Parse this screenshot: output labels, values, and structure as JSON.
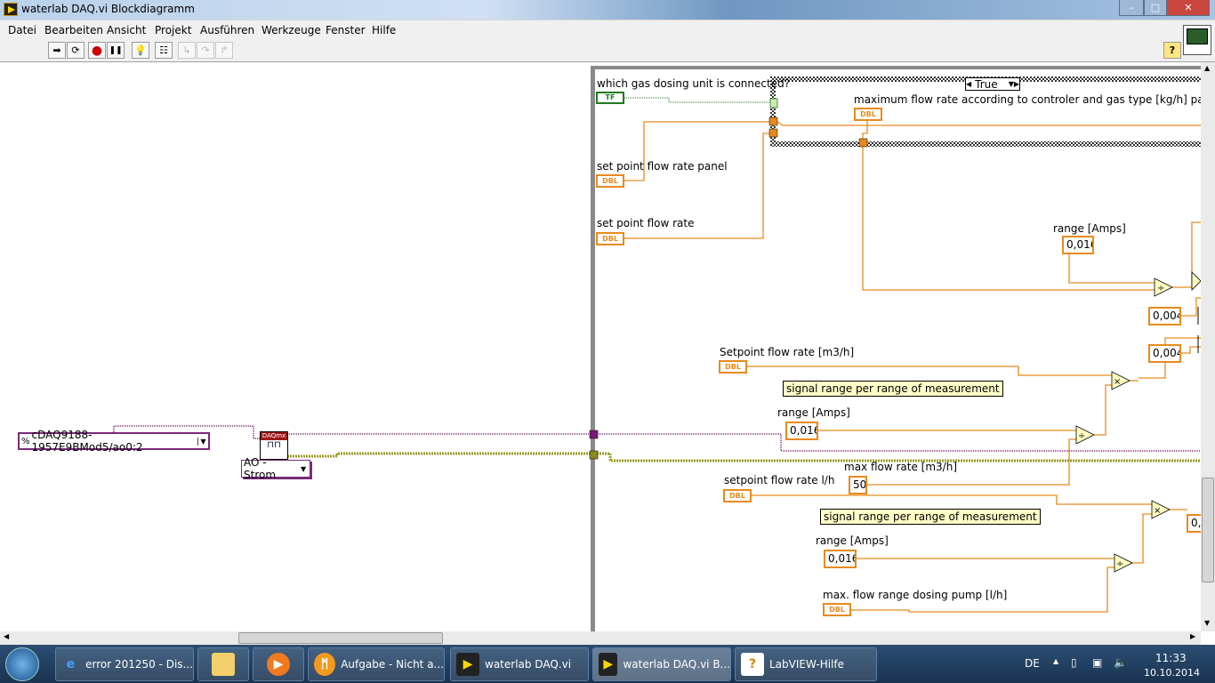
{
  "window": {
    "title": "waterlab DAQ.vi Blockdiagramm",
    "controls": {
      "minimize": "–",
      "maximize": "□",
      "close": "✕"
    }
  },
  "menu": [
    "Datei",
    "Bearbeiten",
    "Ansicht",
    "Projekt",
    "Ausführen",
    "Werkzeuge",
    "Fenster",
    "Hilfe"
  ],
  "toolbar": {
    "run": "➡",
    "run_continuously": "⟳",
    "abort": "●",
    "pause": "❚❚",
    "highlight": "💡",
    "retain_wire_values": "☷",
    "step_into": "↳",
    "step_over": "↷",
    "step_out": "↱",
    "help": "?"
  },
  "diagram": {
    "daq_channel": "cDAQ9188-1957E9BMod5/ao0:2",
    "daq_node_label": "DAQmx",
    "daq_task_type": "AO - Strom",
    "gas_unit_label": "which gas dosing unit is connected?",
    "tf_control": "TF",
    "case_selector": "True",
    "case_selector_prefix": "?",
    "max_flow_rate_label": "maximum flow rate according to controler and gas type [kg/h] par",
    "set_point_panel_label": "set point flow rate panel",
    "set_point_label": "set point flow rate",
    "dbl": "DBL",
    "range_amps_label": "range [Amps]",
    "range_amps_value": "0,016",
    "offset_value": "0,004",
    "setpoint_m3h_label": "Setpoint flow rate [m3/h]",
    "signal_comment": "signal range per range of measurement",
    "max_flow_m3h_label": "max flow rate [m3/h]",
    "max_flow_m3h_value": "50",
    "setpoint_lh_label": "setpoint flow rate l/h",
    "max_pump_label": "max. flow range dosing pump [l/h]",
    "partial_value": "0,",
    "divide": "÷",
    "multiply": "×"
  },
  "taskbar": {
    "items": [
      "error 201250 - Dis...",
      "",
      "",
      "Aufgabe - Nicht a...",
      "waterlab DAQ.vi",
      "waterlab DAQ.vi B...",
      "LabVIEW-Hilfe"
    ],
    "language": "DE",
    "time": "11:33",
    "date": "10.10.2014"
  },
  "colors": {
    "dbl_wire": "#e88a1e",
    "task_wire": "#7a2a7a",
    "error_wire": "#9a9a20",
    "bool_wire": "#1f7a1f"
  }
}
